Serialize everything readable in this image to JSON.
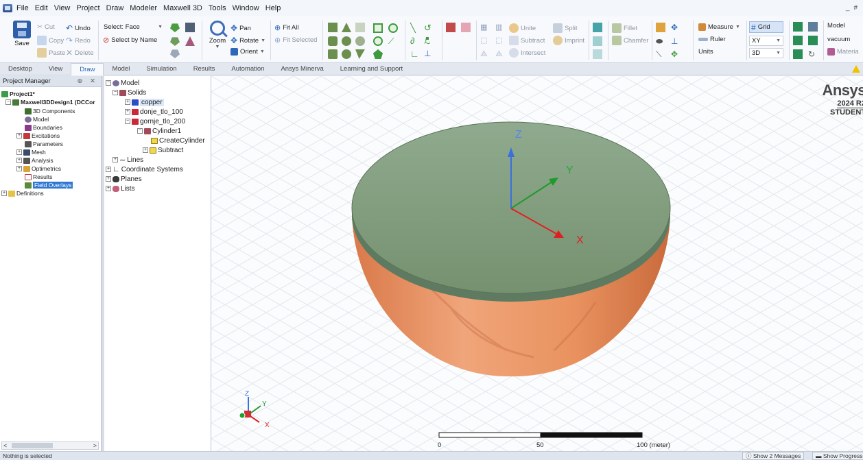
{
  "menu": [
    "File",
    "Edit",
    "View",
    "Project",
    "Draw",
    "Modeler",
    "Maxwell 3D",
    "Tools",
    "Window",
    "Help"
  ],
  "window_controls": [
    "_",
    "#"
  ],
  "ribbon": {
    "save": "Save",
    "cut": "Cut",
    "copy": "Copy",
    "paste": "Paste",
    "undo": "Undo",
    "redo": "Redo",
    "delete": "Delete",
    "select_mode": "Select: Face",
    "select_by_name": "Select by Name",
    "zoom": "Zoom",
    "pan": "Pan",
    "rotate": "Rotate",
    "orient": "Orient",
    "fit_all": "Fit All",
    "fit_selected": "Fit Selected",
    "unite": "Unite",
    "split": "Split",
    "subtract": "Subtract",
    "imprint": "Imprint",
    "intersect": "Intersect",
    "fillet": "Fillet",
    "chamfer": "Chamfer",
    "measure": "Measure",
    "ruler": "Ruler",
    "units": "Units",
    "grid": "Grid",
    "plane": "XY",
    "view_mode": "3D",
    "model_label": "Model",
    "material": "vacuum",
    "material_btn": "Materia"
  },
  "tabs": [
    {
      "label": "Desktop",
      "active": false
    },
    {
      "label": "View",
      "active": false
    },
    {
      "label": "Draw",
      "active": true
    },
    {
      "label": "Model",
      "active": false
    },
    {
      "label": "Simulation",
      "active": false
    },
    {
      "label": "Results",
      "active": false
    },
    {
      "label": "Automation",
      "active": false
    },
    {
      "label": "Ansys Minerva",
      "active": false
    },
    {
      "label": "Learning and Support",
      "active": false
    }
  ],
  "project_manager": {
    "title": "Project Manager",
    "controls": "⊕ ✕",
    "project": "Project1*",
    "design": "Maxwell3DDesign1 (DCCor",
    "items": [
      "3D Components",
      "Model",
      "Boundaries",
      "Excitations",
      "Parameters",
      "Mesh",
      "Analysis",
      "Optimetrics",
      "Results",
      "Field Overlays"
    ],
    "definitions": "Definitions",
    "scroll_left": "<",
    "scroll_right": ">"
  },
  "model_tree": {
    "root": "Model",
    "solids": "Solids",
    "solid_items": [
      "copper",
      "donje_tlo_100",
      "gornje_tlo_200"
    ],
    "cylinder": "Cylinder1",
    "create_cylinder": "CreateCylinder",
    "subtract": "Subtract",
    "lines": "Lines",
    "coord_systems": "Coordinate Systems",
    "planes": "Planes",
    "lists": "Lists"
  },
  "viewport": {
    "brand_name": "Ansys",
    "brand_release": "2024 R2",
    "brand_edition": "STUDENT",
    "axis_x": "X",
    "axis_y": "Y",
    "axis_z": "Z",
    "scale_ticks": [
      "0",
      "50",
      "100 (meter)"
    ],
    "colors": {
      "copper": "#e8925e",
      "cap": "#7d9a7d",
      "axis_x": "#e02020",
      "axis_y": "#1f9a2a",
      "axis_z": "#3a6fe0",
      "grid": "#e4e8ee"
    }
  },
  "status": {
    "message": "Nothing is selected",
    "messages_btn": "Show 2 Messages",
    "progress_btn": "Show Progress"
  }
}
